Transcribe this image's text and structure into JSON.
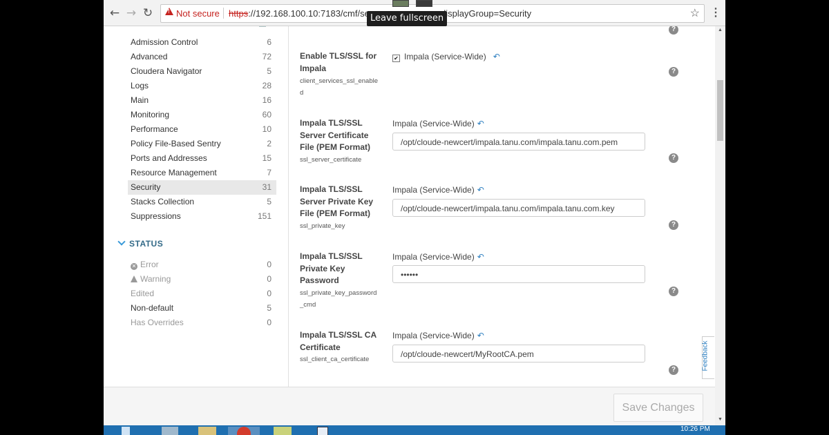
{
  "browser": {
    "back_icon": "arrow-left-icon",
    "forward_icon": "arrow-right-icon",
    "reload_icon": "reload-icon",
    "not_secure_label": "Not secure",
    "url_protocol": "https",
    "url_host": "://192.168.100.10:7183/cmf/serv",
    "url_tail": "displayGroup=Security",
    "fullscreen_tooltip": "Leave fullscreen"
  },
  "sidebar": {
    "categories": [
      {
        "label": "Admission Control",
        "count": "6"
      },
      {
        "label": "Advanced",
        "count": "72"
      },
      {
        "label": "Cloudera Navigator",
        "count": "5"
      },
      {
        "label": "Logs",
        "count": "28"
      },
      {
        "label": "Main",
        "count": "16"
      },
      {
        "label": "Monitoring",
        "count": "60"
      },
      {
        "label": "Performance",
        "count": "10"
      },
      {
        "label": "Policy File-Based Sentry",
        "count": "2"
      },
      {
        "label": "Ports and Addresses",
        "count": "15"
      },
      {
        "label": "Resource Management",
        "count": "7"
      },
      {
        "label": "Security",
        "count": "31"
      },
      {
        "label": "Stacks Collection",
        "count": "5"
      },
      {
        "label": "Suppressions",
        "count": "151"
      }
    ],
    "active_category": "Security",
    "status_heading": "STATUS",
    "status": [
      {
        "label": "Error",
        "count": "0"
      },
      {
        "label": "Warning",
        "count": "0"
      },
      {
        "label": "Edited",
        "count": "0"
      },
      {
        "label": "Non-default",
        "count": "5"
      },
      {
        "label": "Has Overrides",
        "count": "0"
      }
    ]
  },
  "properties": [
    {
      "name": "Enable TLS/SSL for Impala",
      "key": "client_services_ssl_enabled",
      "scope": "Impala (Service-Wide)",
      "checked": true
    },
    {
      "name": "Impala TLS/SSL Server Certificate File (PEM Format)",
      "key": "ssl_server_certificate",
      "scope": "Impala (Service-Wide)",
      "value": "/opt/cloude-newcert/impala.tanu.com/impala.tanu.com.pem"
    },
    {
      "name": "Impala TLS/SSL Server Private Key File (PEM Format)",
      "key": "ssl_private_key",
      "scope": "Impala (Service-Wide)",
      "value": "/opt/cloude-newcert/impala.tanu.com/impala.tanu.com.key"
    },
    {
      "name": "Impala TLS/SSL Private Key Password",
      "key": "ssl_private_key_password_cmd",
      "scope": "Impala (Service-Wide)",
      "value": "••••••"
    },
    {
      "name": "Impala TLS/SSL CA Certificate",
      "key": "ssl_client_ca_certificate",
      "scope": "Impala (Service-Wide)",
      "value": "/opt/cloude-newcert/MyRootCA.pem"
    }
  ],
  "footer": {
    "save_label": "Save Changes"
  },
  "feedback_label": "Feedback",
  "taskbar": {
    "clock": "10:26 PM"
  }
}
